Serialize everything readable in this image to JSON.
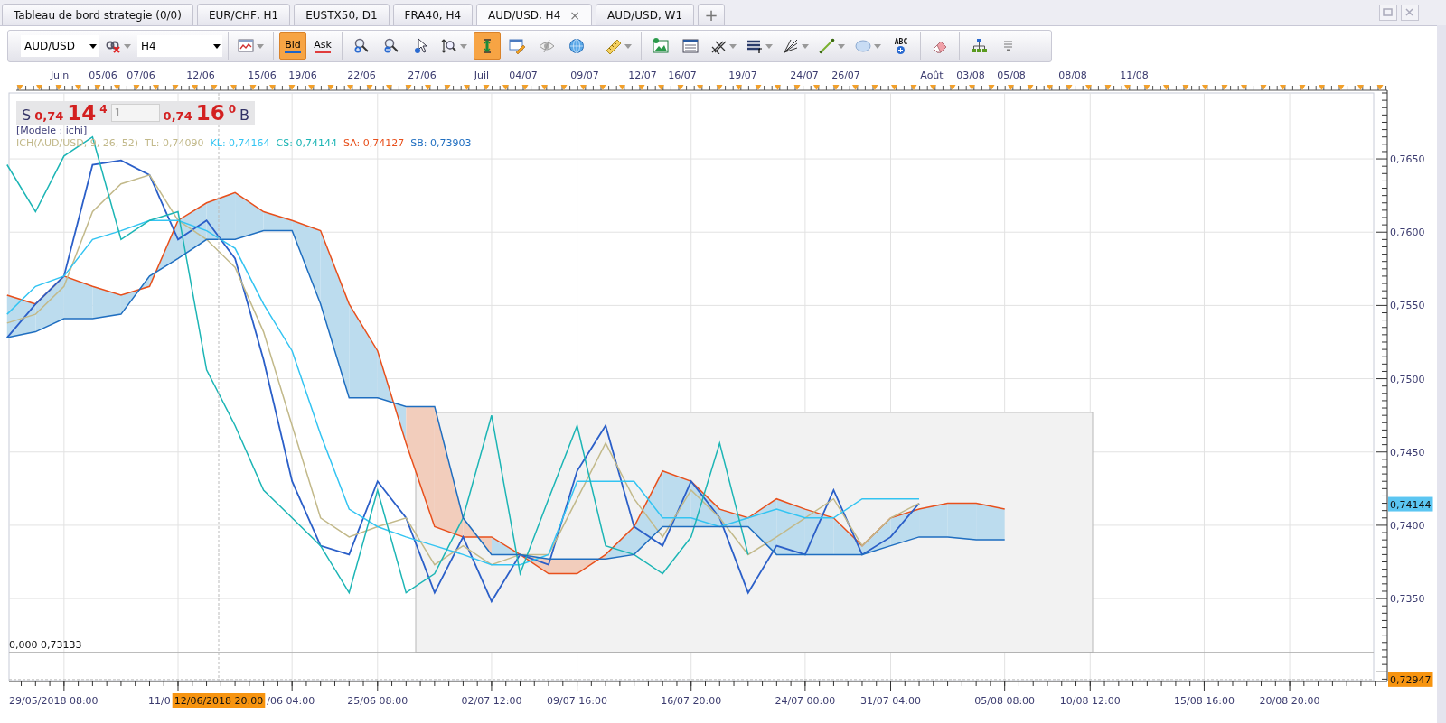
{
  "tabs": [
    {
      "label": "Tableau de bord strategie (0/0)",
      "selected": false
    },
    {
      "label": "EUR/CHF, H1",
      "selected": false
    },
    {
      "label": "EUSTX50, D1",
      "selected": false
    },
    {
      "label": "FRA40, H4",
      "selected": false
    },
    {
      "label": "AUD/USD, H4",
      "selected": true,
      "close": "×"
    },
    {
      "label": "AUD/USD, W1",
      "selected": false
    }
  ],
  "new_tab": "+",
  "toolbar": {
    "items": [
      {
        "kind": "select",
        "value": "AUD/USD"
      },
      {
        "kind": "tool",
        "selected": false,
        "menu": true
      },
      {
        "kind": "select",
        "value": "H4"
      },
      {
        "kind": "separator"
      },
      {
        "kind": "tool",
        "selected": false,
        "menu": true
      },
      {
        "kind": "separator"
      },
      {
        "kind": "price",
        "label": "Bid",
        "selected": true,
        "color": "#1e64c8"
      },
      {
        "kind": "price",
        "label": "Ask",
        "selected": false,
        "color": "#e03c3c"
      },
      {
        "kind": "separator"
      },
      {
        "kind": "tool",
        "selected": false,
        "menu": false
      },
      {
        "kind": "tool",
        "selected": false,
        "menu": false
      },
      {
        "kind": "tool",
        "selected": false,
        "menu": false
      },
      {
        "kind": "tool",
        "selected": false,
        "menu": true
      },
      {
        "kind": "tool",
        "selected": true,
        "menu": false
      },
      {
        "kind": "tool",
        "selected": false,
        "menu": false
      },
      {
        "kind": "tool",
        "selected": false,
        "menu": false
      },
      {
        "kind": "tool",
        "selected": false,
        "menu": false
      },
      {
        "kind": "separator"
      },
      {
        "kind": "tool",
        "selected": false,
        "menu": true
      },
      {
        "kind": "separator"
      },
      {
        "kind": "tool",
        "selected": false,
        "menu": false
      },
      {
        "kind": "tool",
        "selected": false,
        "menu": false
      },
      {
        "kind": "tool",
        "selected": false,
        "menu": true
      },
      {
        "kind": "tool",
        "selected": false,
        "menu": true
      },
      {
        "kind": "tool",
        "selected": false,
        "menu": true
      },
      {
        "kind": "tool",
        "selected": false,
        "menu": true
      },
      {
        "kind": "tool",
        "selected": false,
        "menu": true
      },
      {
        "kind": "tool",
        "selected": false,
        "menu": false,
        "label": "ABC"
      },
      {
        "kind": "separator"
      },
      {
        "kind": "tool",
        "selected": false,
        "menu": false
      },
      {
        "kind": "separator"
      },
      {
        "kind": "tool",
        "selected": false,
        "menu": false
      },
      {
        "kind": "overflow"
      }
    ]
  },
  "date_strip": [
    "Juin",
    "05/06",
    "07/06",
    "12/06",
    "15/06",
    "19/06",
    "22/06",
    "27/06",
    "Juil",
    "04/07",
    "09/07",
    "12/07",
    "16/07",
    "19/07",
    "24/07",
    "26/07",
    "Août",
    "03/08",
    "05/08",
    "08/08",
    "11/08"
  ],
  "quote": {
    "sell": {
      "label": "S",
      "prefix": "0,74",
      "pips": "14",
      "fraction": "4"
    },
    "quantity": {
      "value": "1",
      "disabled": true
    },
    "buy": {
      "prefix": "0,74",
      "pips": "16",
      "fraction": "0",
      "label": "B"
    }
  },
  "legend": {
    "model": "[Modele : ichi]",
    "items": [
      {
        "text": "ICH(AUD/USD, 9, 26, 52)",
        "color": "#c2b98a"
      },
      {
        "text": "TL: 0,74090",
        "color": "#c2b98a"
      },
      {
        "text": "KL: 0,74164",
        "color": "#33c4f2"
      },
      {
        "text": "CS: 0,74144",
        "color": "#1cb5b5"
      },
      {
        "text": "SA: 0,74127",
        "color": "#e8501c"
      },
      {
        "text": "SB: 0,73903",
        "color": "#1f6ec0"
      }
    ]
  },
  "chart_data": {
    "type": "line",
    "grid": true,
    "ylim": [
      0.7294,
      0.7695
    ],
    "ref_lines": [
      {
        "axis": "y",
        "value": 0.73133,
        "label": "0,000 0,73133"
      },
      {
        "axis": "y",
        "value": 0.72947,
        "label": "0,72947"
      }
    ],
    "categories": [
      null,
      null,
      null,
      null,
      null,
      null,
      null,
      null,
      null,
      null,
      null,
      null,
      null,
      "25/06 08:00",
      null,
      null,
      null,
      "02/07 12:00",
      null,
      null,
      "09/07 16:00",
      null,
      null,
      null,
      "16/07 20:00",
      null,
      null,
      null,
      "24/07 00:00",
      null,
      null,
      "31/07 04:00",
      null,
      null,
      null,
      "05/08 08:00",
      null,
      null,
      "10/08 12:00",
      null,
      null,
      null,
      "15/08 16:00",
      null,
      null,
      "20/08 20:00",
      null,
      null
    ],
    "series": [
      {
        "color": "#2b5fc8",
        "values": [
          0.7528,
          0.7551,
          0.757,
          0.7646,
          0.7649,
          0.7639,
          0.7595,
          0.7608,
          0.7582,
          0.7513,
          0.743,
          0.7386,
          0.738,
          0.743,
          0.7405,
          0.7354,
          0.7392,
          0.7348,
          0.738,
          0.7373,
          0.7437,
          0.7468,
          0.7399,
          0.7386,
          0.743,
          0.7405,
          0.7354,
          0.7386,
          0.738,
          0.7424,
          0.738,
          0.7392,
          0.7415,
          null,
          null,
          null,
          null,
          null,
          null,
          null,
          null,
          null,
          null,
          null,
          null,
          null,
          null,
          null
        ]
      },
      {
        "color": "#c2b98a",
        "values": [
          0.7538,
          0.7544,
          0.7563,
          0.7614,
          0.7633,
          0.7639,
          0.7608,
          0.7595,
          0.7576,
          0.7532,
          0.7468,
          0.7405,
          0.7392,
          0.7399,
          0.7405,
          0.7373,
          0.7386,
          0.7373,
          0.738,
          0.738,
          0.7418,
          0.7456,
          0.7418,
          0.7392,
          0.7424,
          0.7405,
          0.738,
          0.7392,
          0.7405,
          0.7418,
          0.7386,
          0.7405,
          0.7415,
          null,
          null,
          null,
          null,
          null,
          null,
          null,
          null,
          null,
          null,
          null,
          null,
          null,
          null,
          null
        ]
      },
      {
        "color": "#33c4f2",
        "values": [
          0.7544,
          0.7563,
          0.757,
          0.7595,
          0.7601,
          0.7608,
          0.7608,
          0.7601,
          0.7589,
          0.7551,
          0.7519,
          0.7462,
          0.7411,
          0.7399,
          0.7392,
          0.7386,
          0.738,
          0.7373,
          0.7373,
          0.738,
          0.743,
          0.743,
          0.743,
          0.7405,
          0.7405,
          0.7399,
          0.7405,
          0.7411,
          0.7405,
          0.7405,
          0.7418,
          0.7418,
          0.7418,
          null,
          null,
          null,
          null,
          null,
          null,
          null,
          null,
          null,
          null,
          null,
          null,
          null,
          null,
          null
        ]
      },
      {
        "color": "#1cb5b5",
        "values": [
          0.7646,
          0.7614,
          0.7652,
          0.7665,
          0.7595,
          0.7608,
          0.7614,
          0.7506,
          0.7468,
          0.7424,
          0.7405,
          0.7386,
          0.7354,
          0.7424,
          0.7354,
          0.7367,
          0.7405,
          0.7475,
          0.7367,
          0.7418,
          0.7468,
          0.7386,
          0.738,
          0.7367,
          0.7392,
          0.7456,
          0.738,
          null,
          null,
          null,
          null,
          null,
          null,
          null,
          null,
          null,
          null,
          null,
          null,
          null,
          null,
          null,
          null,
          null,
          null,
          null,
          null,
          null
        ]
      },
      {
        "color": "#e8501c",
        "values": [
          0.7557,
          0.7551,
          0.757,
          0.7563,
          0.7557,
          0.7563,
          0.7608,
          0.762,
          0.7627,
          0.7614,
          0.7608,
          0.7601,
          0.7551,
          0.7519,
          0.7456,
          0.7399,
          0.7392,
          0.7392,
          0.738,
          0.7367,
          0.7367,
          0.738,
          0.7399,
          0.7437,
          0.743,
          0.7411,
          0.7405,
          0.7418,
          0.7411,
          0.7405,
          0.7386,
          0.7405,
          0.7411,
          0.7415,
          0.7415,
          0.7411,
          null,
          null,
          null,
          null,
          null,
          null,
          null,
          null,
          null,
          null,
          null,
          null
        ]
      },
      {
        "color": "#1f6ec0",
        "values": [
          0.7528,
          0.7532,
          0.7541,
          0.7541,
          0.7544,
          0.757,
          0.7582,
          0.7595,
          0.7595,
          0.7601,
          0.7601,
          0.7551,
          0.7487,
          0.7487,
          0.7481,
          0.7481,
          0.7405,
          0.738,
          0.738,
          0.7377,
          0.7377,
          0.7377,
          0.738,
          0.7399,
          0.7399,
          0.7399,
          0.7399,
          0.738,
          0.738,
          0.738,
          0.738,
          0.7386,
          0.7392,
          0.7392,
          0.739,
          0.739,
          null,
          null,
          null,
          null,
          null,
          null,
          null,
          null,
          null,
          null,
          null,
          null
        ]
      }
    ],
    "yticks": [
      {
        "value": 0.735,
        "label": "0,7350"
      },
      {
        "value": 0.74,
        "label": "0,7400"
      },
      {
        "value": 0.745,
        "label": "0,7450"
      },
      {
        "value": 0.75,
        "label": "0,7500"
      },
      {
        "value": 0.755,
        "label": "0,7550"
      },
      {
        "value": 0.76,
        "label": "0,7600"
      },
      {
        "value": 0.765,
        "label": "0,7650"
      }
    ]
  },
  "time_axis": {
    "start_label": "29/05/2018 08:00",
    "fragments": [
      "11/0",
      "/06 04:00"
    ]
  },
  "last_price": "0,74144",
  "crosshair": {
    "date": "12/06/2018 20:00"
  }
}
